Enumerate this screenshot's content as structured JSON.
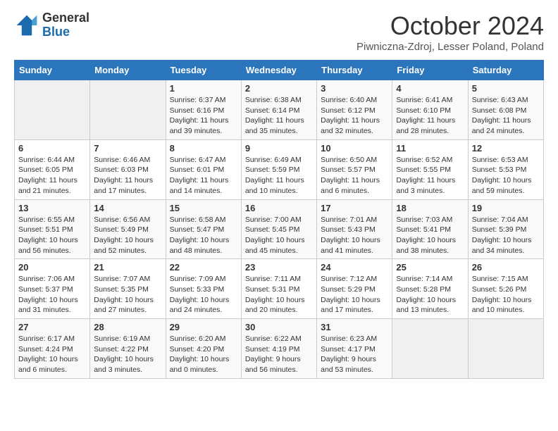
{
  "logo": {
    "general": "General",
    "blue": "Blue"
  },
  "header": {
    "month": "October 2024",
    "location": "Piwniczna-Zdroj, Lesser Poland, Poland"
  },
  "days_of_week": [
    "Sunday",
    "Monday",
    "Tuesday",
    "Wednesday",
    "Thursday",
    "Friday",
    "Saturday"
  ],
  "weeks": [
    [
      {
        "day": "",
        "info": ""
      },
      {
        "day": "",
        "info": ""
      },
      {
        "day": "1",
        "info": "Sunrise: 6:37 AM\nSunset: 6:16 PM\nDaylight: 11 hours and 39 minutes."
      },
      {
        "day": "2",
        "info": "Sunrise: 6:38 AM\nSunset: 6:14 PM\nDaylight: 11 hours and 35 minutes."
      },
      {
        "day": "3",
        "info": "Sunrise: 6:40 AM\nSunset: 6:12 PM\nDaylight: 11 hours and 32 minutes."
      },
      {
        "day": "4",
        "info": "Sunrise: 6:41 AM\nSunset: 6:10 PM\nDaylight: 11 hours and 28 minutes."
      },
      {
        "day": "5",
        "info": "Sunrise: 6:43 AM\nSunset: 6:08 PM\nDaylight: 11 hours and 24 minutes."
      }
    ],
    [
      {
        "day": "6",
        "info": "Sunrise: 6:44 AM\nSunset: 6:05 PM\nDaylight: 11 hours and 21 minutes."
      },
      {
        "day": "7",
        "info": "Sunrise: 6:46 AM\nSunset: 6:03 PM\nDaylight: 11 hours and 17 minutes."
      },
      {
        "day": "8",
        "info": "Sunrise: 6:47 AM\nSunset: 6:01 PM\nDaylight: 11 hours and 14 minutes."
      },
      {
        "day": "9",
        "info": "Sunrise: 6:49 AM\nSunset: 5:59 PM\nDaylight: 11 hours and 10 minutes."
      },
      {
        "day": "10",
        "info": "Sunrise: 6:50 AM\nSunset: 5:57 PM\nDaylight: 11 hours and 6 minutes."
      },
      {
        "day": "11",
        "info": "Sunrise: 6:52 AM\nSunset: 5:55 PM\nDaylight: 11 hours and 3 minutes."
      },
      {
        "day": "12",
        "info": "Sunrise: 6:53 AM\nSunset: 5:53 PM\nDaylight: 10 hours and 59 minutes."
      }
    ],
    [
      {
        "day": "13",
        "info": "Sunrise: 6:55 AM\nSunset: 5:51 PM\nDaylight: 10 hours and 56 minutes."
      },
      {
        "day": "14",
        "info": "Sunrise: 6:56 AM\nSunset: 5:49 PM\nDaylight: 10 hours and 52 minutes."
      },
      {
        "day": "15",
        "info": "Sunrise: 6:58 AM\nSunset: 5:47 PM\nDaylight: 10 hours and 48 minutes."
      },
      {
        "day": "16",
        "info": "Sunrise: 7:00 AM\nSunset: 5:45 PM\nDaylight: 10 hours and 45 minutes."
      },
      {
        "day": "17",
        "info": "Sunrise: 7:01 AM\nSunset: 5:43 PM\nDaylight: 10 hours and 41 minutes."
      },
      {
        "day": "18",
        "info": "Sunrise: 7:03 AM\nSunset: 5:41 PM\nDaylight: 10 hours and 38 minutes."
      },
      {
        "day": "19",
        "info": "Sunrise: 7:04 AM\nSunset: 5:39 PM\nDaylight: 10 hours and 34 minutes."
      }
    ],
    [
      {
        "day": "20",
        "info": "Sunrise: 7:06 AM\nSunset: 5:37 PM\nDaylight: 10 hours and 31 minutes."
      },
      {
        "day": "21",
        "info": "Sunrise: 7:07 AM\nSunset: 5:35 PM\nDaylight: 10 hours and 27 minutes."
      },
      {
        "day": "22",
        "info": "Sunrise: 7:09 AM\nSunset: 5:33 PM\nDaylight: 10 hours and 24 minutes."
      },
      {
        "day": "23",
        "info": "Sunrise: 7:11 AM\nSunset: 5:31 PM\nDaylight: 10 hours and 20 minutes."
      },
      {
        "day": "24",
        "info": "Sunrise: 7:12 AM\nSunset: 5:29 PM\nDaylight: 10 hours and 17 minutes."
      },
      {
        "day": "25",
        "info": "Sunrise: 7:14 AM\nSunset: 5:28 PM\nDaylight: 10 hours and 13 minutes."
      },
      {
        "day": "26",
        "info": "Sunrise: 7:15 AM\nSunset: 5:26 PM\nDaylight: 10 hours and 10 minutes."
      }
    ],
    [
      {
        "day": "27",
        "info": "Sunrise: 6:17 AM\nSunset: 4:24 PM\nDaylight: 10 hours and 6 minutes."
      },
      {
        "day": "28",
        "info": "Sunrise: 6:19 AM\nSunset: 4:22 PM\nDaylight: 10 hours and 3 minutes."
      },
      {
        "day": "29",
        "info": "Sunrise: 6:20 AM\nSunset: 4:20 PM\nDaylight: 10 hours and 0 minutes."
      },
      {
        "day": "30",
        "info": "Sunrise: 6:22 AM\nSunset: 4:19 PM\nDaylight: 9 hours and 56 minutes."
      },
      {
        "day": "31",
        "info": "Sunrise: 6:23 AM\nSunset: 4:17 PM\nDaylight: 9 hours and 53 minutes."
      },
      {
        "day": "",
        "info": ""
      },
      {
        "day": "",
        "info": ""
      }
    ]
  ]
}
